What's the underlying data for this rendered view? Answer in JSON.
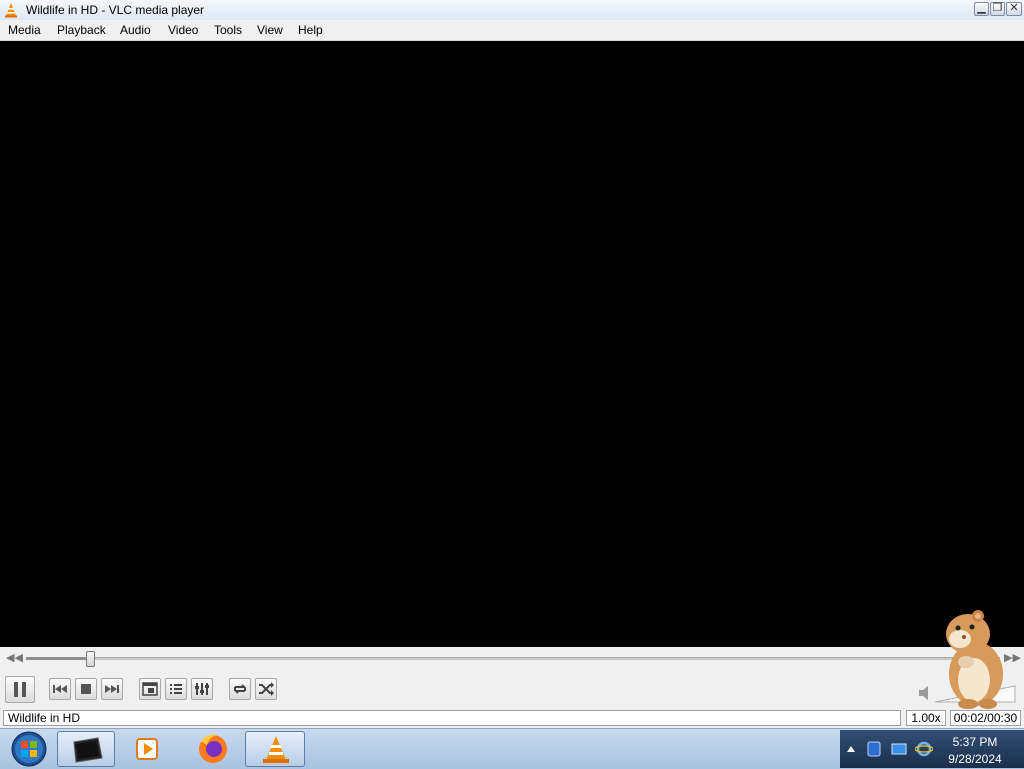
{
  "window": {
    "title": "Wildlife in HD - VLC media player",
    "controls": [
      "minimize-icon",
      "restore-icon",
      "close-icon"
    ]
  },
  "menu": {
    "items": [
      "Media",
      "Playback",
      "Audio",
      "Video",
      "Tools",
      "View",
      "Help"
    ]
  },
  "playback": {
    "position_fraction": 0.066,
    "state": "playing"
  },
  "controls": {
    "buttons": [
      "pause-icon",
      "previous-icon",
      "stop-icon",
      "next-icon",
      "fullscreen-icon",
      "playlist-icon",
      "extended-settings-icon",
      "loop-icon",
      "shuffle-icon"
    ]
  },
  "status": {
    "media_title": "Wildlife in HD",
    "speed": "1.00x",
    "time": "00:02/00:30"
  },
  "taskbar": {
    "apps": [
      "start-orb-icon",
      "terminal-icon",
      "media-player-icon",
      "firefox-icon",
      "vlc-icon"
    ],
    "tray_icons": [
      "show-hidden-icons-icon",
      "defender-icon",
      "network-icon",
      "ie-icon"
    ],
    "clock_time": "5:37 PM",
    "clock_date": "9/28/2024"
  },
  "colors": {
    "vlc_orange": "#f28c00",
    "video_bg": "#000000",
    "taskbar": "#b7cde8"
  }
}
